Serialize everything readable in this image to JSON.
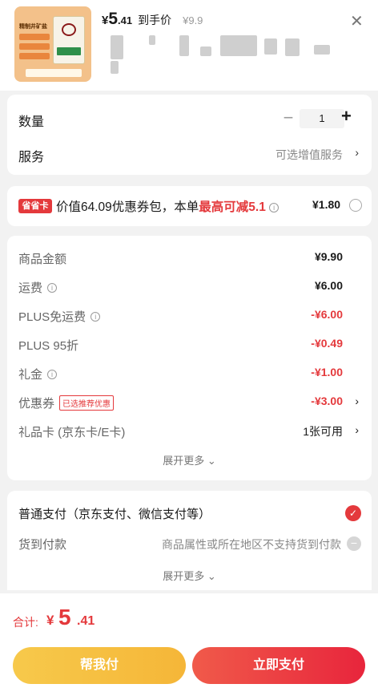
{
  "product": {
    "price_symbol": "¥",
    "price_int": "5",
    "price_dec": ".41",
    "arrival_label": "到手价",
    "original_price": "¥9.9",
    "thumb_title": "精制井矿盐"
  },
  "quantity": {
    "label": "数量",
    "value": "1",
    "minus": "−",
    "plus": "+"
  },
  "service": {
    "label": "服务",
    "value": "可选增值服务",
    "chevron": "›"
  },
  "coupon": {
    "badge": "省省卡",
    "text_a": "价值64.09优惠券包，本单",
    "text_b": "最高可减5.1",
    "price": "¥1.80"
  },
  "fees": [
    {
      "label": "商品金额",
      "value": "¥9.90",
      "info": false,
      "red": false
    },
    {
      "label": "运费",
      "value": "¥6.00",
      "info": true,
      "red": false
    },
    {
      "label": "PLUS免运费",
      "value": "-¥6.00",
      "info": true,
      "red": true
    },
    {
      "label": "PLUS 95折",
      "value": "-¥0.49",
      "info": false,
      "red": true
    },
    {
      "label": "礼金",
      "value": "-¥1.00",
      "info": true,
      "red": true
    },
    {
      "label": "优惠券",
      "badge": "已选推荐优惠",
      "value": "-¥3.00",
      "red": true,
      "chevron": "›"
    },
    {
      "label": "礼品卡 (京东卡/E卡)",
      "value": "1张可用",
      "red": false,
      "chevron": "›"
    }
  ],
  "fees_more": "展开更多 ⌄",
  "payment": {
    "normal_label": "普通支付（京东支付、微信支付等）",
    "cod_label": "货到付款",
    "cod_note": "商品属性或所在地区不支持货到付款",
    "more": "展开更多 ⌄"
  },
  "footer": {
    "total_label": "合计:",
    "total_yen": "¥",
    "total_int": "5",
    "total_dec": ".41",
    "help_pay": "帮我付",
    "pay": "立即支付"
  },
  "colors": {
    "accent": "#e4393c",
    "help_button": "#f5b638"
  }
}
